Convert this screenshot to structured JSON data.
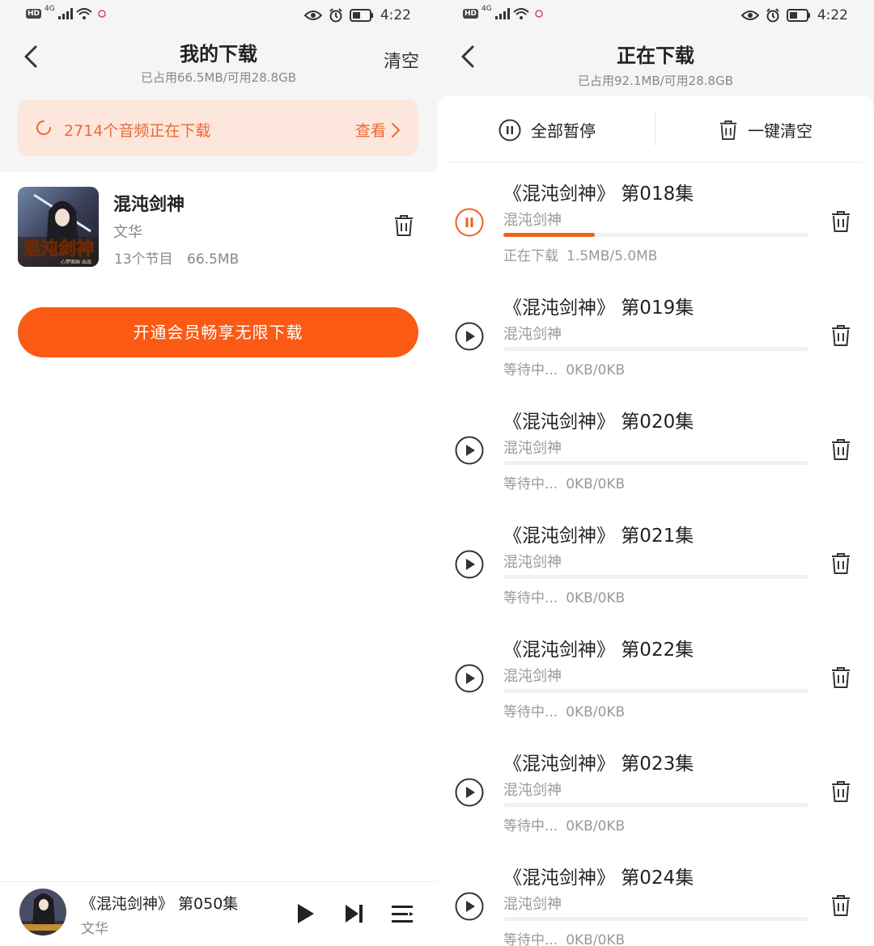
{
  "status_bar": {
    "network": "4G",
    "time": "4:22"
  },
  "left": {
    "title": "我的下载",
    "storage": "已占用66.5MB/可用28.8GB",
    "clear_label": "清空",
    "downloading_banner": {
      "count_text": "2714个音频正在下载",
      "view_label": "查看"
    },
    "album": {
      "title": "混沌剑神",
      "author": "文华",
      "episodes": "13个节目",
      "size": "66.5MB",
      "cover_text": "混沌剑神",
      "cover_subtext": "心梦图画 出品"
    },
    "vip_button": "开通会员畅享无限下载",
    "mini_player": {
      "title": "《混沌剑神》 第050集",
      "author": "文华"
    }
  },
  "right": {
    "title": "正在下载",
    "storage": "已占用92.1MB/可用28.8GB",
    "pause_all": "全部暂停",
    "clear_all": "一键清空",
    "items": [
      {
        "title": "《混沌剑神》 第018集",
        "album": "混沌剑神",
        "status": "正在下载",
        "size": "1.5MB/5.0MB",
        "progress": 0.3,
        "state": "downloading"
      },
      {
        "title": "《混沌剑神》 第019集",
        "album": "混沌剑神",
        "status": "等待中...",
        "size": "0KB/0KB",
        "progress": 0,
        "state": "waiting"
      },
      {
        "title": "《混沌剑神》 第020集",
        "album": "混沌剑神",
        "status": "等待中...",
        "size": "0KB/0KB",
        "progress": 0,
        "state": "waiting"
      },
      {
        "title": "《混沌剑神》 第021集",
        "album": "混沌剑神",
        "status": "等待中...",
        "size": "0KB/0KB",
        "progress": 0,
        "state": "waiting"
      },
      {
        "title": "《混沌剑神》 第022集",
        "album": "混沌剑神",
        "status": "等待中...",
        "size": "0KB/0KB",
        "progress": 0,
        "state": "waiting"
      },
      {
        "title": "《混沌剑神》 第023集",
        "album": "混沌剑神",
        "status": "等待中...",
        "size": "0KB/0KB",
        "progress": 0,
        "state": "waiting"
      },
      {
        "title": "《混沌剑神》 第024集",
        "album": "混沌剑神",
        "status": "等待中...",
        "size": "0KB/0KB",
        "progress": 0,
        "state": "waiting"
      }
    ]
  },
  "colors": {
    "accent": "#fa5a14",
    "banner_bg": "#fde6dc",
    "banner_text": "#e86a35",
    "progress": "#f0601e"
  }
}
